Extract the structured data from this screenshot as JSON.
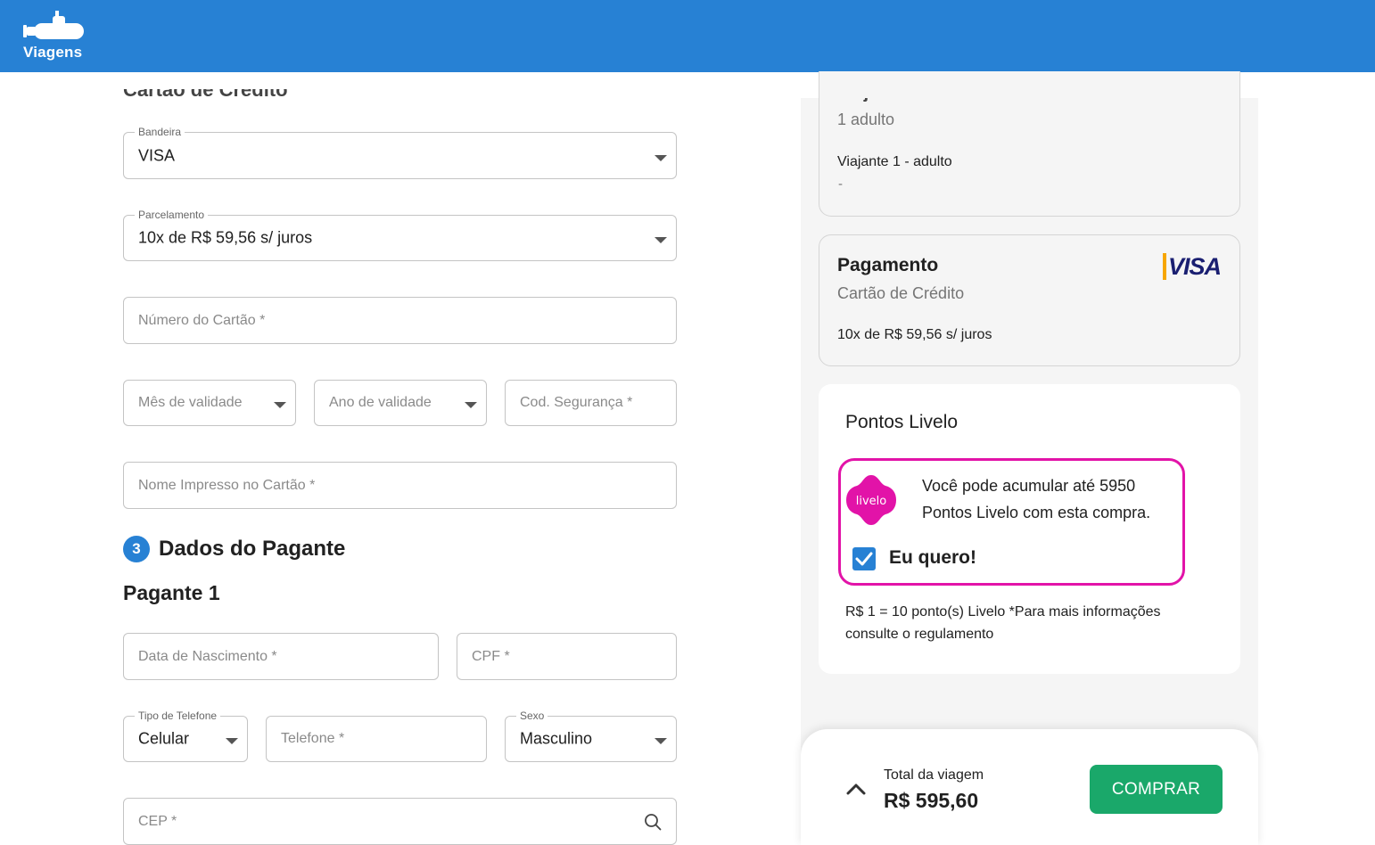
{
  "header": {
    "brand": "Viagens"
  },
  "payment_form": {
    "section_title_partial": "Cartão de Crédito",
    "bandeira": {
      "label": "Bandeira",
      "value": "VISA"
    },
    "parcelamento": {
      "label": "Parcelamento",
      "value": "10x de R$ 59,56 s/ juros"
    },
    "numero_cartao": {
      "placeholder": "Número do Cartão *"
    },
    "mes_validade": {
      "placeholder": "Mês de validade"
    },
    "ano_validade": {
      "placeholder": "Ano de validade"
    },
    "cod_seguranca": {
      "placeholder": "Cod. Segurança *"
    },
    "nome_impresso": {
      "placeholder": "Nome Impresso no Cartão *"
    }
  },
  "payer": {
    "step_number": "3",
    "section_title": "Dados do Pagante",
    "subtitle": "Pagante 1",
    "data_nascimento": {
      "placeholder": "Data de Nascimento *"
    },
    "cpf": {
      "placeholder": "CPF *"
    },
    "tipo_telefone": {
      "label": "Tipo de Telefone",
      "value": "Celular"
    },
    "telefone": {
      "placeholder": "Telefone *"
    },
    "sexo": {
      "label": "Sexo",
      "value": "Masculino"
    },
    "cep": {
      "placeholder": "CEP *"
    }
  },
  "summary": {
    "travelers": {
      "title_partial": "Viajantes",
      "count": "1 adulto",
      "traveler_label": "Viajante 1 - adulto",
      "traveler_value": "-"
    },
    "payment": {
      "title": "Pagamento",
      "method": "Cartão de Crédito",
      "brand_logo": "VISA",
      "installments": "10x de R$ 59,56 s/ juros"
    },
    "livelo": {
      "title": "Pontos Livelo",
      "logo_text": "livelo",
      "message_line1": "Você pode acumular até 5950",
      "message_line2": "Pontos Livelo com esta compra.",
      "checkbox_label": "Eu quero!",
      "checked": true,
      "note_line1": "R$ 1 = 10 ponto(s) Livelo *Para mais informações",
      "note_line2": "consulte o regulamento"
    }
  },
  "footer": {
    "total_label": "Total da viagem",
    "total_value": "R$ 595,60",
    "buy_button": "COMPRAR"
  },
  "colors": {
    "primary": "#2781d4",
    "buy": "#1aa86a",
    "livelo": "#e213a8",
    "visa": "#1a1f71"
  }
}
